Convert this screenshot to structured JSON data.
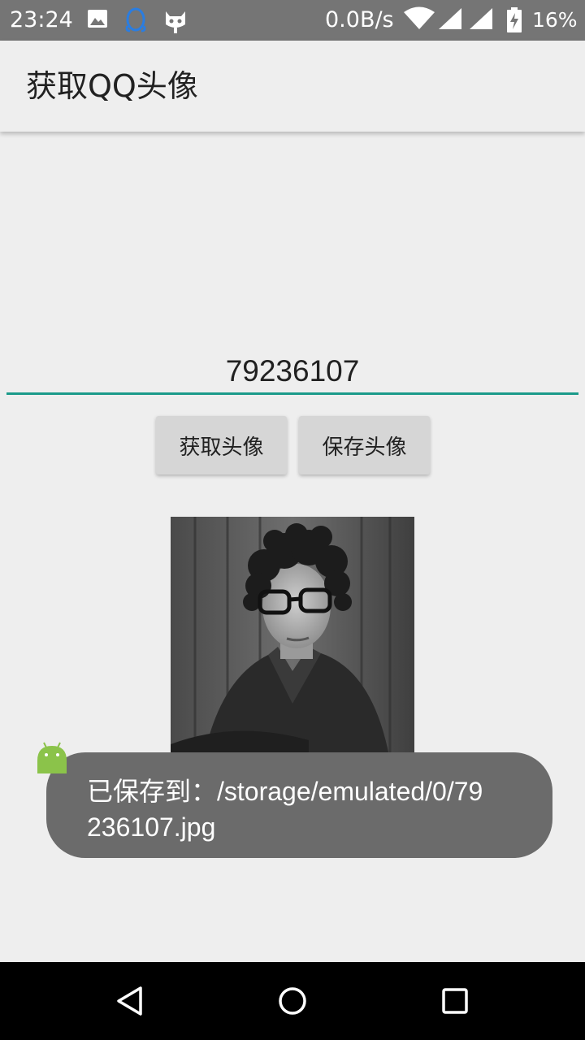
{
  "status_bar": {
    "time": "23:24",
    "net_speed": "0.0B/s",
    "battery": "16%",
    "icons": [
      "image-notification-icon",
      "qq-penguin-icon",
      "cat-notification-icon",
      "wifi-icon",
      "signal-icon",
      "signal-icon",
      "battery-charging-icon"
    ]
  },
  "app_bar": {
    "title": "获取QQ头像"
  },
  "input": {
    "value": "79236107"
  },
  "buttons": {
    "get_label": "获取头像",
    "save_label": "保存头像"
  },
  "avatar": {
    "description_icon": "avatar-photo"
  },
  "toast": {
    "message": "已保存到：/storage/emulated/0/79236107.jpg"
  },
  "nav_bar": {
    "icons": [
      "back-icon",
      "home-icon",
      "recents-icon"
    ]
  },
  "colors": {
    "status_bar": "#757575",
    "background": "#eeeeee",
    "accent": "#1a9a8a",
    "button": "#d6d6d6",
    "toast": "#6b6b6b",
    "nav_bar": "#000000"
  }
}
